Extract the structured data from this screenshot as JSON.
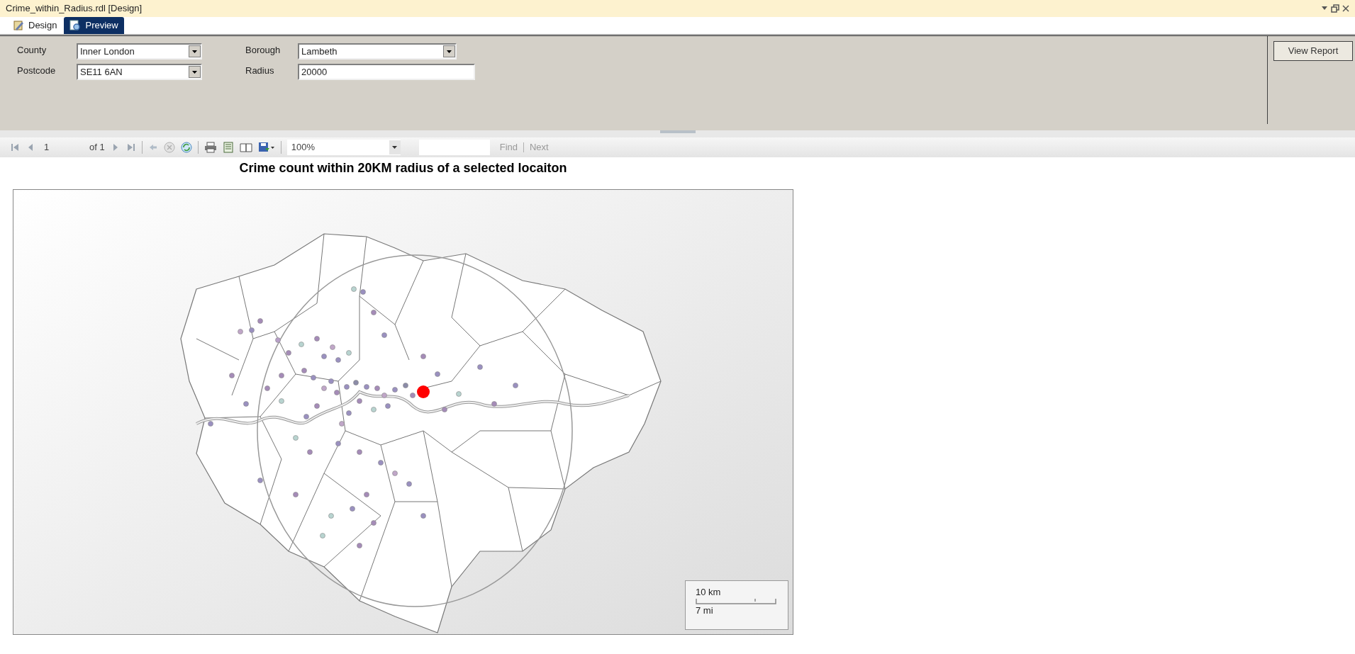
{
  "window": {
    "title": "Crime_within_Radius.rdl [Design]"
  },
  "tabs": [
    {
      "label": "Design",
      "selected": false
    },
    {
      "label": "Preview",
      "selected": true
    }
  ],
  "parameters": [
    {
      "label": "County",
      "value": "Inner London",
      "kind": "dropdown"
    },
    {
      "label": "Borough",
      "value": "Lambeth",
      "kind": "dropdown"
    },
    {
      "label": "Postcode",
      "value": "SE11 6AN",
      "kind": "dropdown"
    },
    {
      "label": "Radius",
      "value": "20000",
      "kind": "text"
    }
  ],
  "view_report_button": "View Report",
  "toolbar": {
    "page": "1",
    "of": "of 1",
    "zoom": "100%",
    "find": "Find",
    "next": "Next"
  },
  "report": {
    "title": "Crime count within 20KM radius of a selected locaiton",
    "scale_km": "10 km",
    "scale_mi": "7 mi"
  }
}
